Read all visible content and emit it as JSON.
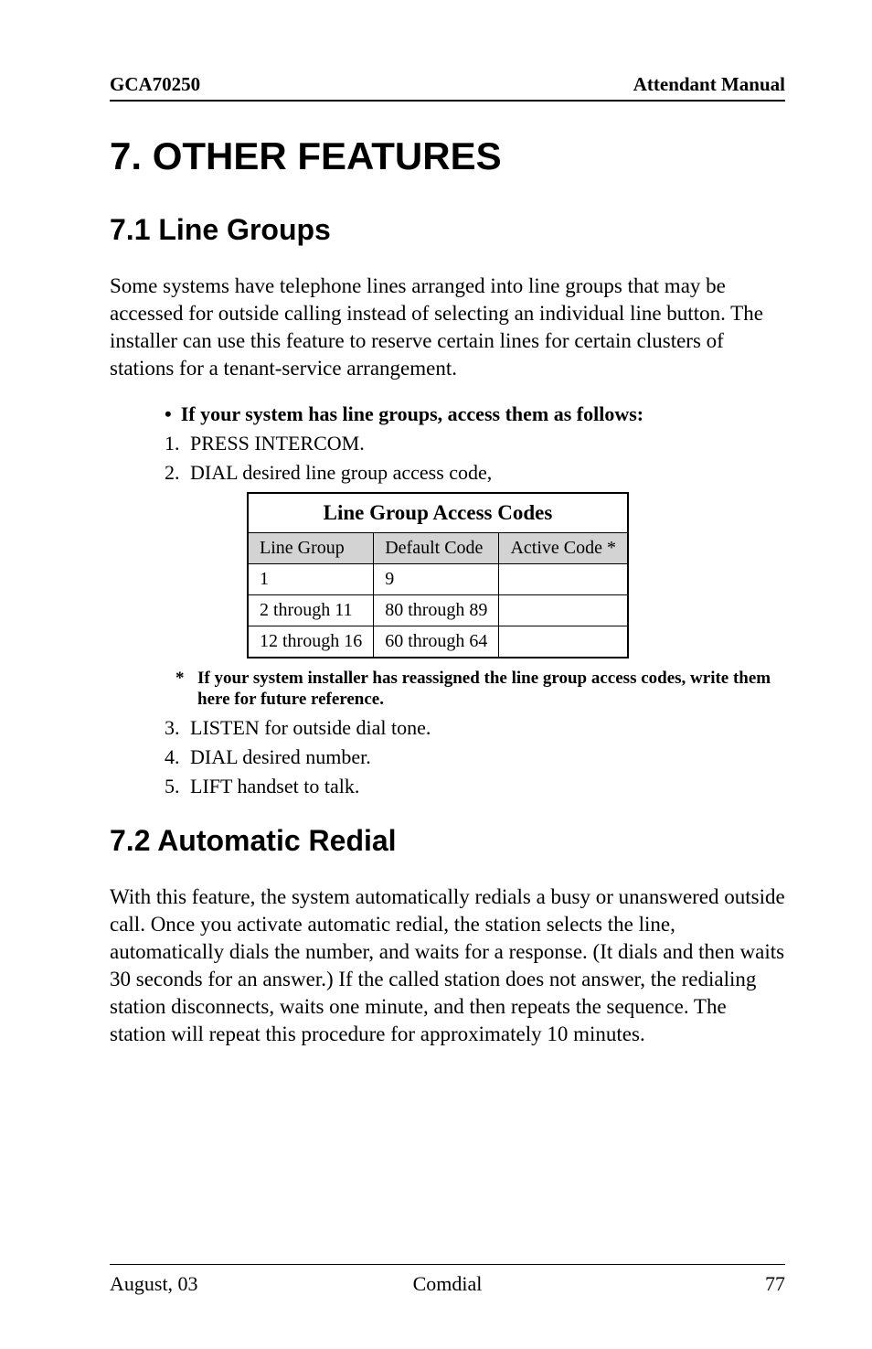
{
  "header": {
    "left": "GCA70250",
    "right": "Attendant Manual"
  },
  "chapter_title": "7.  OTHER FEATURES",
  "section_7_1": {
    "title": "7.1  Line Groups",
    "body": "Some systems have telephone lines arranged into line groups that may be accessed for outside calling instead of selecting an individual line button.  The installer can use this feature to reserve certain lines for certain clusters of stations for a tenant-service arrangement.",
    "bullet": "If your system has line groups, access them as follows:",
    "steps_before_table": [
      {
        "num": "1.",
        "text": "PRESS INTERCOM."
      },
      {
        "num": "2.",
        "text": "DIAL desired line group access code,"
      }
    ],
    "table": {
      "title": "Line Group Access Codes",
      "headers": [
        "Line Group",
        "Default Code",
        "Active Code *"
      ],
      "rows": [
        [
          "1",
          "9",
          ""
        ],
        [
          "2 through 11",
          "80 through 89",
          ""
        ],
        [
          "12 through 16",
          "60 through 64",
          ""
        ]
      ]
    },
    "footnote_star": "*",
    "footnote": "If your system installer has reassigned the line group access codes, write them here for future reference.",
    "steps_after_table": [
      {
        "num": "3.",
        "text": "LISTEN for outside dial tone."
      },
      {
        "num": "4.",
        "text": "DIAL desired number."
      },
      {
        "num": "5.",
        "text": "LIFT handset to talk."
      }
    ]
  },
  "section_7_2": {
    "title": "7.2  Automatic Redial",
    "body": "With this feature, the system automatically redials a busy or unanswered outside call.  Once you activate automatic redial, the station selects the line, automatically dials the number, and waits for a response.  (It dials and then waits 30 seconds for an answer.)  If the called station does not answer, the redialing station disconnects, waits one minute, and then repeats the sequence.  The station will repeat this procedure for approximately 10 minutes."
  },
  "footer": {
    "left": "August, 03",
    "center": "Comdial",
    "right": "77"
  }
}
